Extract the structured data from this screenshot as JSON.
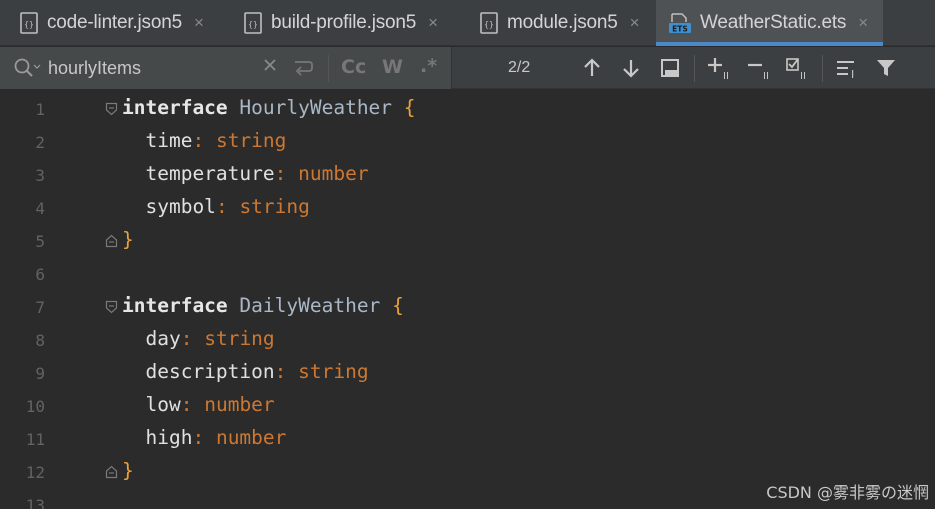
{
  "tabs": [
    {
      "label": "code-linter.json5",
      "icon": "json5-file-icon",
      "active": false
    },
    {
      "label": "build-profile.json5",
      "icon": "json5-file-icon",
      "active": false
    },
    {
      "label": "module.json5",
      "icon": "json5-file-icon",
      "active": false
    },
    {
      "label": "WeatherStatic.ets",
      "icon": "ets-file-icon",
      "active": true
    }
  ],
  "close_glyph": "×",
  "search": {
    "query": "hourlyItems",
    "match_count": "2/2",
    "options": [
      "Cc",
      "W",
      ".*"
    ]
  },
  "editor": {
    "line_numbers": [
      "1",
      "2",
      "3",
      "4",
      "5",
      "6",
      "7",
      "8",
      "9",
      "10",
      "11",
      "12",
      "13"
    ],
    "lines": [
      {
        "keyword": "interface",
        "name": "HourlyWeather",
        "brace": "{"
      },
      {
        "prop": "time",
        "colon": ":",
        "type": "string"
      },
      {
        "prop": "temperature",
        "colon": ":",
        "type": "number"
      },
      {
        "prop": "symbol",
        "colon": ":",
        "type": "string"
      },
      {
        "brace": "}"
      },
      {},
      {
        "keyword": "interface",
        "name": "DailyWeather",
        "brace": "{"
      },
      {
        "prop": "day",
        "colon": ":",
        "type": "string"
      },
      {
        "prop": "description",
        "colon": ":",
        "type": "string"
      },
      {
        "prop": "low",
        "colon": ":",
        "type": "number"
      },
      {
        "prop": "high",
        "colon": ":",
        "type": "number"
      },
      {
        "brace": "}"
      }
    ]
  },
  "watermark": "CSDN @雾非雾の迷惘",
  "colors": {
    "keyword": "#cc7832",
    "type": "#cc7832",
    "brace": "#e9a23b",
    "accent": "#4a88c7",
    "background": "#2b2b2b"
  }
}
